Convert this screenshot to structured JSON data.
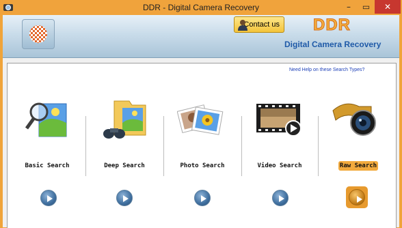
{
  "window": {
    "title": "DDR - Digital Camera Recovery",
    "minimize_glyph": "–",
    "maximize_glyph": "▭",
    "close_glyph": "✕"
  },
  "header": {
    "contact_label": "Contact us",
    "brand": "DDR",
    "product_name": "Digital Camera Recovery"
  },
  "main": {
    "help_link": "Need Help on these Search Types?",
    "search_types": [
      {
        "label": "Basic Search",
        "icon": "magnifier-photo-icon",
        "selected": false
      },
      {
        "label": "Deep Search",
        "icon": "binoculars-folder-icon",
        "selected": false
      },
      {
        "label": "Photo Search",
        "icon": "photos-icon",
        "selected": false
      },
      {
        "label": "Video Search",
        "icon": "film-strip-icon",
        "selected": false
      },
      {
        "label": "Raw Search",
        "icon": "camera-lens-film-icon",
        "selected": true
      }
    ]
  },
  "colors": {
    "titlebar": "#f0a33c",
    "close_button": "#c7372f",
    "selected_accent": "#f2aa3e",
    "link": "#1c3fb8",
    "subtitle": "#1f5aa8"
  }
}
